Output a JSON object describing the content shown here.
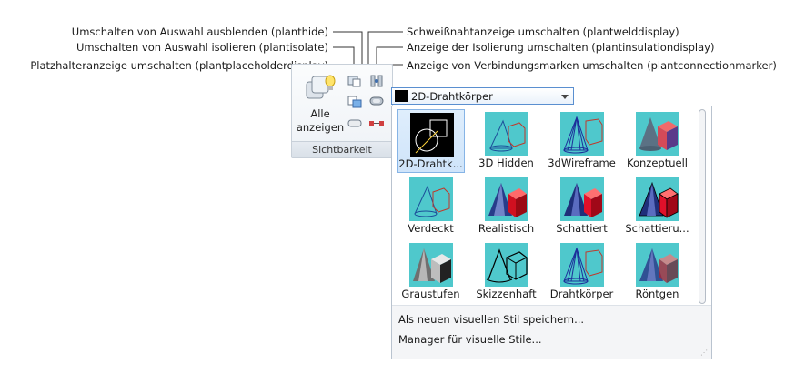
{
  "callouts": {
    "left": [
      "Umschalten von Auswahl ausblenden (planthide)",
      "Umschalten von Auswahl isolieren (plantisolate)",
      "Platzhalteranzeige umschalten (plantplaceholderdisplay)"
    ],
    "right": [
      "Schweißnahtanzeige umschalten (plantwelddisplay)",
      "Anzeige der Isolierung umschalten (plantinsulationdisplay)",
      "Anzeige von Verbindungsmarken umschalten (plantconnectionmarker)"
    ]
  },
  "panel": {
    "show_all_label_1": "Alle",
    "show_all_label_2": "anzeigen",
    "footer": "Sichtbarkeit"
  },
  "visual_style": {
    "current": "2D-Drahtkörper",
    "styles": [
      {
        "label": "2D-Drahtk...",
        "icon": "wireframe-2d-icon",
        "selected": true
      },
      {
        "label": "3D Hidden",
        "icon": "hidden-3d-icon"
      },
      {
        "label": "3dWireframe",
        "icon": "wireframe-3d-icon"
      },
      {
        "label": "Konzeptuell",
        "icon": "conceptual-icon"
      },
      {
        "label": "Verdeckt",
        "icon": "hidden-icon"
      },
      {
        "label": "Realistisch",
        "icon": "realistic-icon"
      },
      {
        "label": "Schattiert",
        "icon": "shaded-icon"
      },
      {
        "label": "Schattieru...",
        "icon": "shaded-edges-icon"
      },
      {
        "label": "Graustufen",
        "icon": "grayscale-icon"
      },
      {
        "label": "Skizzenhaft",
        "icon": "sketchy-icon"
      },
      {
        "label": "Drahtkörper",
        "icon": "wireframe-icon"
      },
      {
        "label": "Röntgen",
        "icon": "xray-icon"
      }
    ],
    "menu": {
      "save_as_new": "Als neuen visuellen Stil speichern...",
      "manager": "Manager für visuelle Stile..."
    }
  }
}
